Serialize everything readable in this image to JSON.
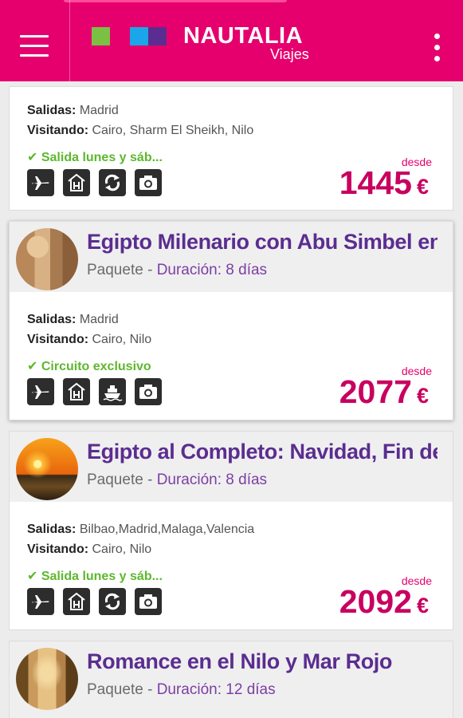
{
  "header": {
    "brand": "NAUTALIA",
    "brand_sub": "Viajes",
    "colors": {
      "header_bg": "#e5006e",
      "logo_green": "#7bc043",
      "logo_blue": "#1aa6e8",
      "logo_purple": "#5b2d90"
    },
    "menu_icon": "hamburger-menu-icon",
    "more_icon": "kebab-menu-icon"
  },
  "labels": {
    "salidas": "Salidas:",
    "visitando": "Visitando:",
    "desde": "desde",
    "currency": "€",
    "duracion": "Duración:",
    "separator": "-"
  },
  "cards": [
    {
      "title": "",
      "type": "",
      "duration": "",
      "salidas": "Madrid",
      "visitando": "Cairo, Sharm El Sheikh, Nilo",
      "badge": "Salida lunes y sáb...",
      "services": [
        "flight-icon",
        "hotel-icon",
        "transfer-icon",
        "excursion-icon"
      ],
      "price": "1445"
    },
    {
      "title": "Egipto Milenario con Abu Simbel en...",
      "type": "Paquete",
      "duration": "8 días",
      "salidas": "Madrid",
      "visitando": "Cairo, Nilo",
      "badge": "Circuito exclusivo",
      "services": [
        "flight-icon",
        "hotel-icon",
        "cruise-icon",
        "excursion-icon"
      ],
      "price": "2077"
    },
    {
      "title": "Egipto al Completo: Navidad, Fin de...",
      "type": "Paquete",
      "duration": "8 días",
      "salidas": "Bilbao,Madrid,Malaga,Valencia",
      "visitando": "Cairo, Nilo",
      "badge": "Salida lunes y sáb...",
      "services": [
        "flight-icon",
        "hotel-icon",
        "transfer-icon",
        "excursion-icon"
      ],
      "price": "2092"
    },
    {
      "title": "Romance en el Nilo y Mar Rojo",
      "type": "Paquete",
      "duration": "12 días",
      "price": ""
    }
  ]
}
